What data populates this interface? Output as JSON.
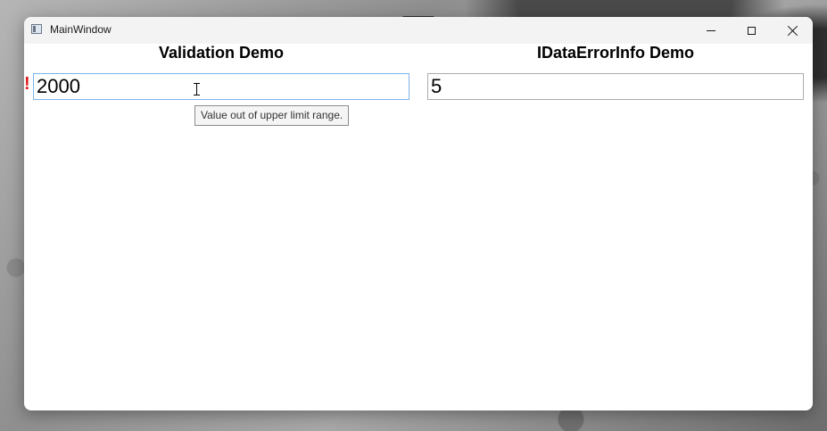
{
  "window": {
    "title": "MainWindow"
  },
  "left_panel": {
    "heading": "Validation Demo",
    "input_value": "2000",
    "error_indicator": "!",
    "tooltip": "Value out of upper limit range."
  },
  "right_panel": {
    "heading": "IDataErrorInfo Demo",
    "input_value": "5"
  },
  "icons": {
    "app": "window-app-icon",
    "minimize": "minimize-icon",
    "maximize": "maximize-icon",
    "close": "close-icon",
    "cursor": "text-cursor-icon",
    "snap": "snap-layout-handle-icon"
  },
  "colors": {
    "error": "#e11d1d",
    "focus_border": "#7eb4ea",
    "titlebar": "#f3f3f3"
  }
}
